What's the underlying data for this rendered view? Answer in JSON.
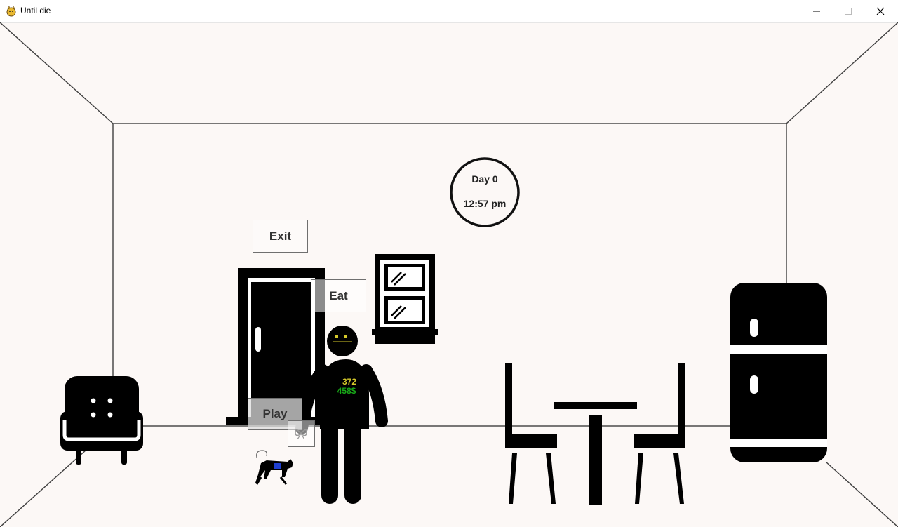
{
  "window": {
    "title": "Until die",
    "minimize_symbol": "—",
    "maximize_symbol": "☐",
    "close_symbol": "✕"
  },
  "clock": {
    "day": "Day 0",
    "time": "12:57 pm"
  },
  "buttons": {
    "exit": "Exit",
    "eat": "Eat",
    "play": "Play"
  },
  "player": {
    "energy": "372",
    "money": "458$"
  },
  "colors": {
    "background": "#fcf8f6",
    "lines": "#404040",
    "furniture": "#000000",
    "energy_text": "#d4c82a",
    "money_text": "#18a818",
    "cat_collar": "#1f3fd0"
  },
  "icons": [
    "app-icon",
    "armchair-icon",
    "door-icon",
    "window-icon",
    "player-figure",
    "cat-icon",
    "table-icon",
    "chair-icon",
    "fridge-icon",
    "clock-icon"
  ]
}
